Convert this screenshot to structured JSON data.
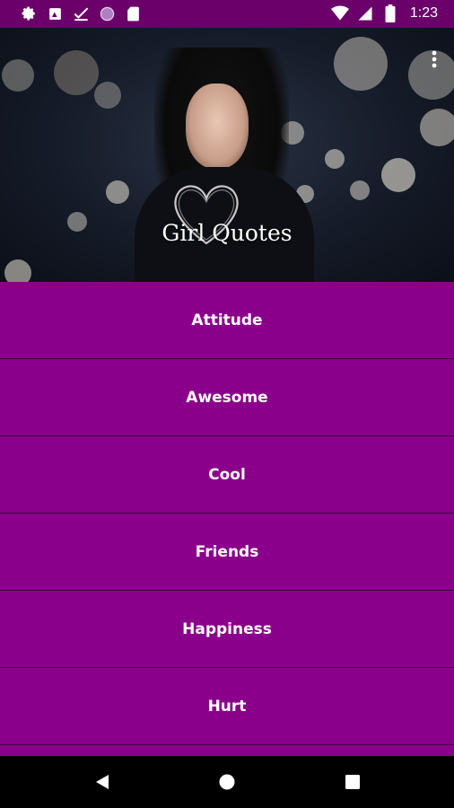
{
  "status_bar": {
    "time": "1:23",
    "left_icons": [
      "gear-icon",
      "image-icon",
      "check-icon",
      "circle-icon",
      "sd-card-icon"
    ],
    "right_icons": [
      "wifi-icon",
      "signal-icon",
      "battery-icon"
    ]
  },
  "header": {
    "title": "Girl Quotes"
  },
  "categories": [
    "Attitude",
    "Awesome",
    "Cool",
    "Friends",
    "Happiness",
    "Hurt"
  ],
  "colors": {
    "status_bar": "#6b006b",
    "list_item_background": "#8b008b",
    "divider": "#3a003a",
    "text": "#ffffff",
    "nav_bar": "#000000"
  },
  "nav": [
    "back-icon",
    "home-icon",
    "recents-icon"
  ]
}
